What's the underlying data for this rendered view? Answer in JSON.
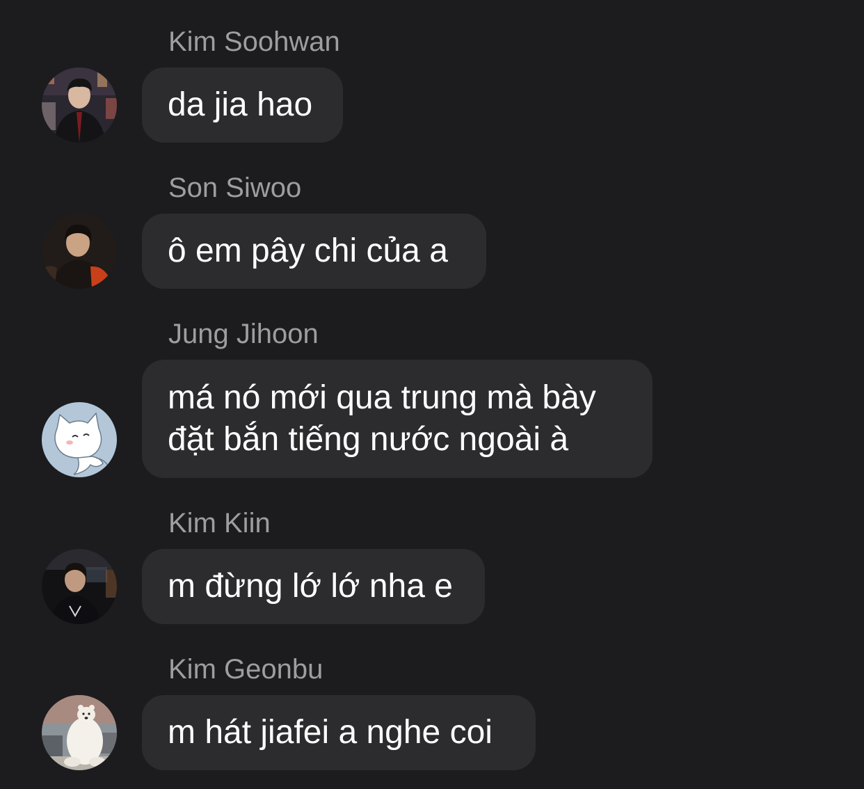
{
  "messages": [
    {
      "sender": "Kim Soohwan",
      "text": "da jia hao",
      "avatar": "photo-man-night-city-avatar"
    },
    {
      "sender": "Son Siwoo",
      "text": "ô em pây chi của a",
      "avatar": "photo-man-dark-background-avatar"
    },
    {
      "sender": "Jung Jihoon",
      "text_line1": "má nó mới qua trung mà bày",
      "text_line2": "đặt bắn tiếng nước ngoài à",
      "avatar": "white-cat-cartoon-avatar"
    },
    {
      "sender": "Kim Kiin",
      "text": "m đừng lớ lớ nha e",
      "avatar": "photo-player-stage-avatar"
    },
    {
      "sender": "Kim Geonbu",
      "text": "m hát jiafei a nghe coi",
      "avatar": "polar-bear-photo-avatar"
    }
  ],
  "colors": {
    "background": "#1c1c1e",
    "bubble": "#2c2c2e",
    "sender_text": "#9d9da2",
    "message_text": "#ffffff"
  }
}
